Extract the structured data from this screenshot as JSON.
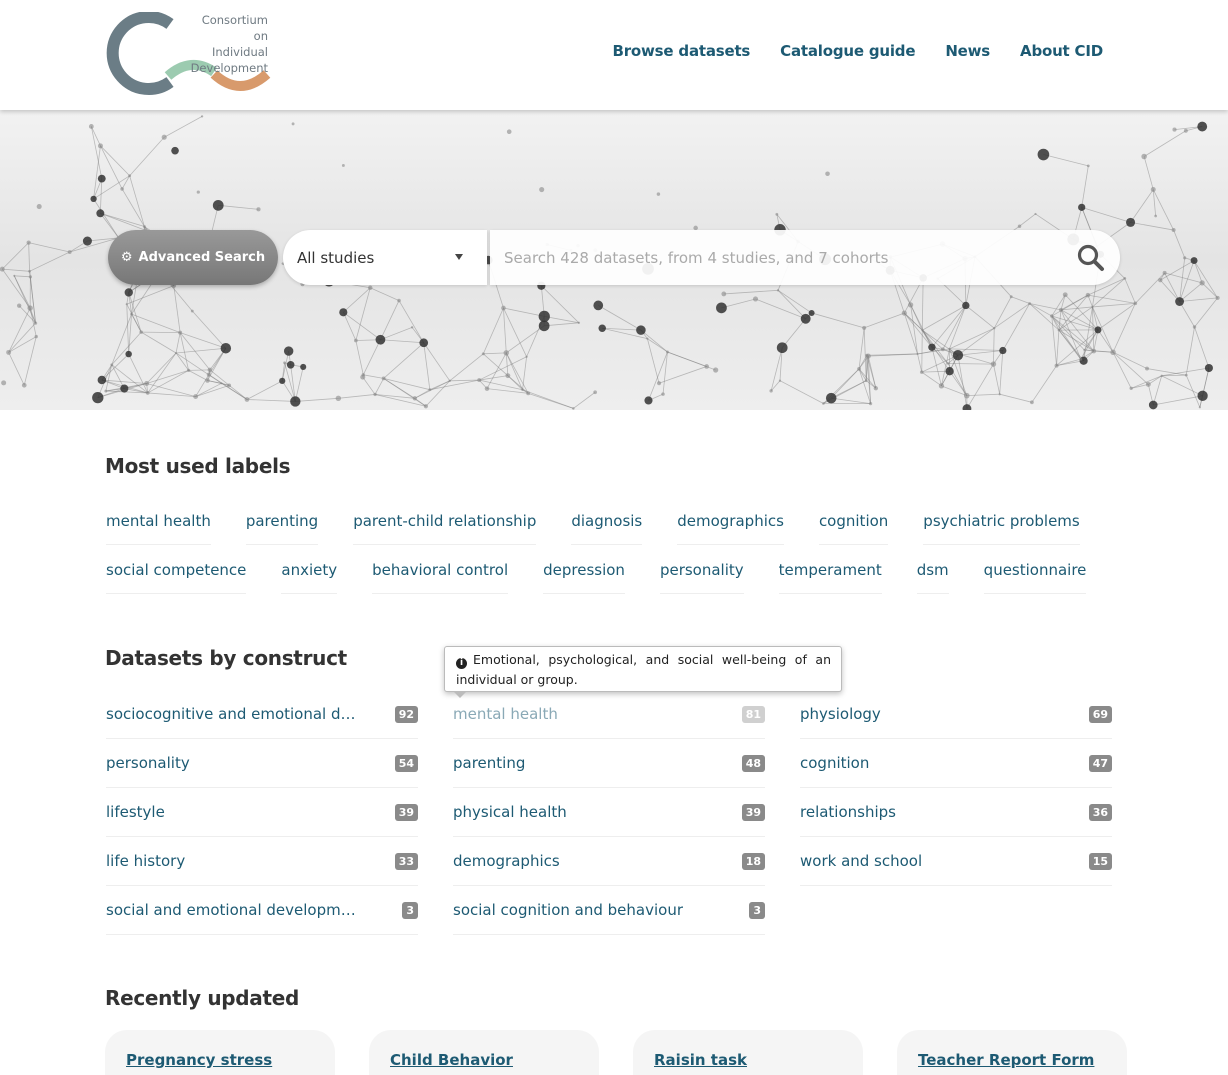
{
  "header": {
    "logo_text": [
      "Consortium on",
      "Individual",
      "Development"
    ],
    "nav": [
      "Browse datasets",
      "Catalogue guide",
      "News",
      "About CID"
    ]
  },
  "search": {
    "advanced_label": "Advanced Search",
    "study_select": "All studies",
    "placeholder": "Search 428 datasets, from 4 studies, and 7 cohorts"
  },
  "labels_section": {
    "title": "Most used labels",
    "row1": [
      "mental health",
      "parenting",
      "parent-child relationship",
      "diagnosis",
      "demographics",
      "cognition",
      "psychiatric problems"
    ],
    "row2": [
      "social competence",
      "anxiety",
      "behavioral control",
      "depression",
      "personality",
      "temperament",
      "dsm",
      "questionnaire"
    ]
  },
  "constructs_section": {
    "title": "Datasets by construct",
    "tooltip": "Emotional, psychological, and social well-being of an individual or group.",
    "columns": [
      [
        {
          "name": "sociocognitive and emotional de...",
          "count": "92"
        },
        {
          "name": "personality",
          "count": "54"
        },
        {
          "name": "lifestyle",
          "count": "39"
        },
        {
          "name": "life history",
          "count": "33"
        },
        {
          "name": "social and emotional developme...",
          "count": "3"
        }
      ],
      [
        {
          "name": "mental health",
          "count": "81"
        },
        {
          "name": "parenting",
          "count": "48"
        },
        {
          "name": "physical health",
          "count": "39"
        },
        {
          "name": "demographics",
          "count": "18"
        },
        {
          "name": "social cognition and behaviour",
          "count": "3"
        }
      ],
      [
        {
          "name": "physiology",
          "count": "69"
        },
        {
          "name": "cognition",
          "count": "47"
        },
        {
          "name": "relationships",
          "count": "36"
        },
        {
          "name": "work and school",
          "count": "15"
        }
      ]
    ]
  },
  "recent_section": {
    "title": "Recently updated",
    "cards": [
      "Pregnancy stress",
      "Child Behavior",
      "Raisin task",
      "Teacher Report Form"
    ]
  },
  "colors": {
    "link": "#1d5a73",
    "logo_gray": "#6b7d86",
    "logo_green": "#9ccbb0",
    "logo_orange": "#d89a6c"
  }
}
